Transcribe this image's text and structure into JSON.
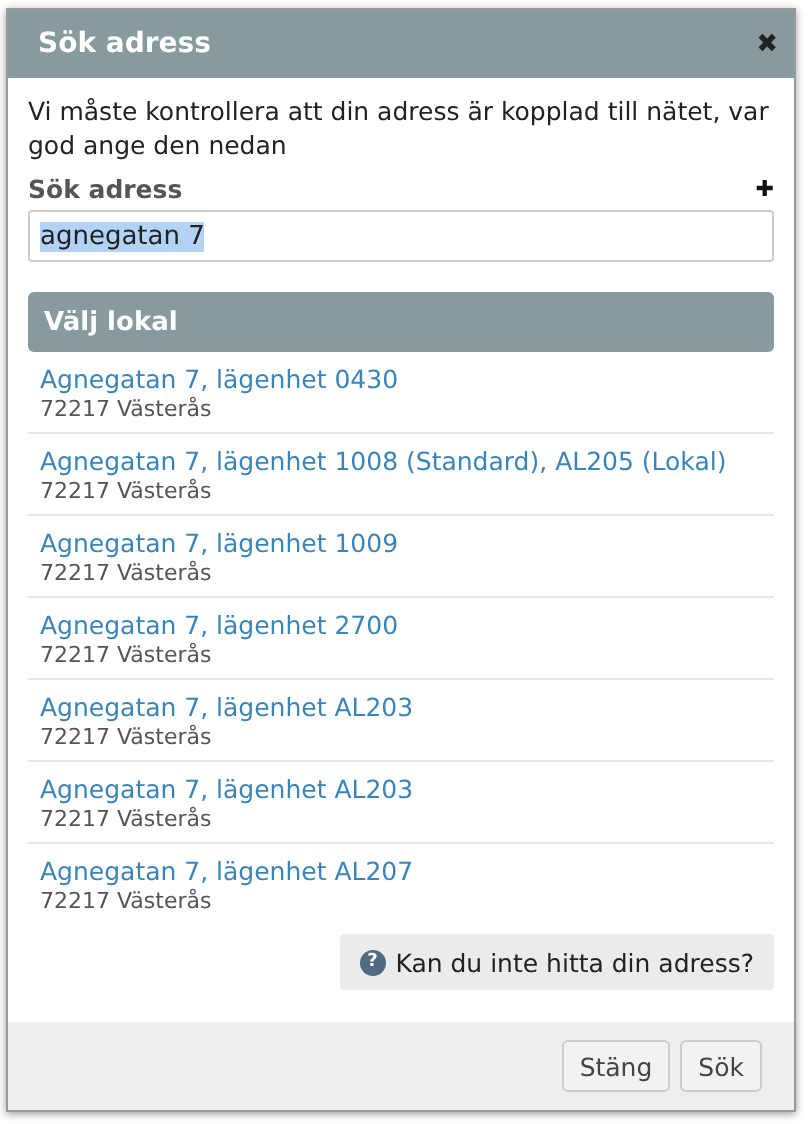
{
  "dialog": {
    "title": "Sök adress",
    "close_icon": "✖"
  },
  "intro": "Vi måste kontrollera att din adress är kopplad till nätet, var god ange den nedan",
  "search": {
    "label": "Sök adress",
    "add_icon": "✚",
    "value": "agnegatan 7",
    "value_selected": true
  },
  "list": {
    "heading": "Välj lokal",
    "items": [
      {
        "address": "Agnegatan 7, lägenhet 0430",
        "city": "72217 Västerås"
      },
      {
        "address": "Agnegatan 7, lägenhet 1008 (Standard), AL205 (Lokal)",
        "city": "72217 Västerås"
      },
      {
        "address": "Agnegatan 7, lägenhet 1009",
        "city": "72217 Västerås"
      },
      {
        "address": "Agnegatan 7, lägenhet 2700",
        "city": "72217 Västerås"
      },
      {
        "address": "Agnegatan 7, lägenhet AL203",
        "city": "72217 Västerås"
      },
      {
        "address": "Agnegatan 7, lägenhet AL203",
        "city": "72217 Västerås"
      },
      {
        "address": "Agnegatan 7, lägenhet AL207",
        "city": "72217 Västerås"
      }
    ]
  },
  "help": {
    "label": "Kan du inte hitta din adress?",
    "icon": "?"
  },
  "buttons": [
    "Stäng",
    "Sök"
  ]
}
